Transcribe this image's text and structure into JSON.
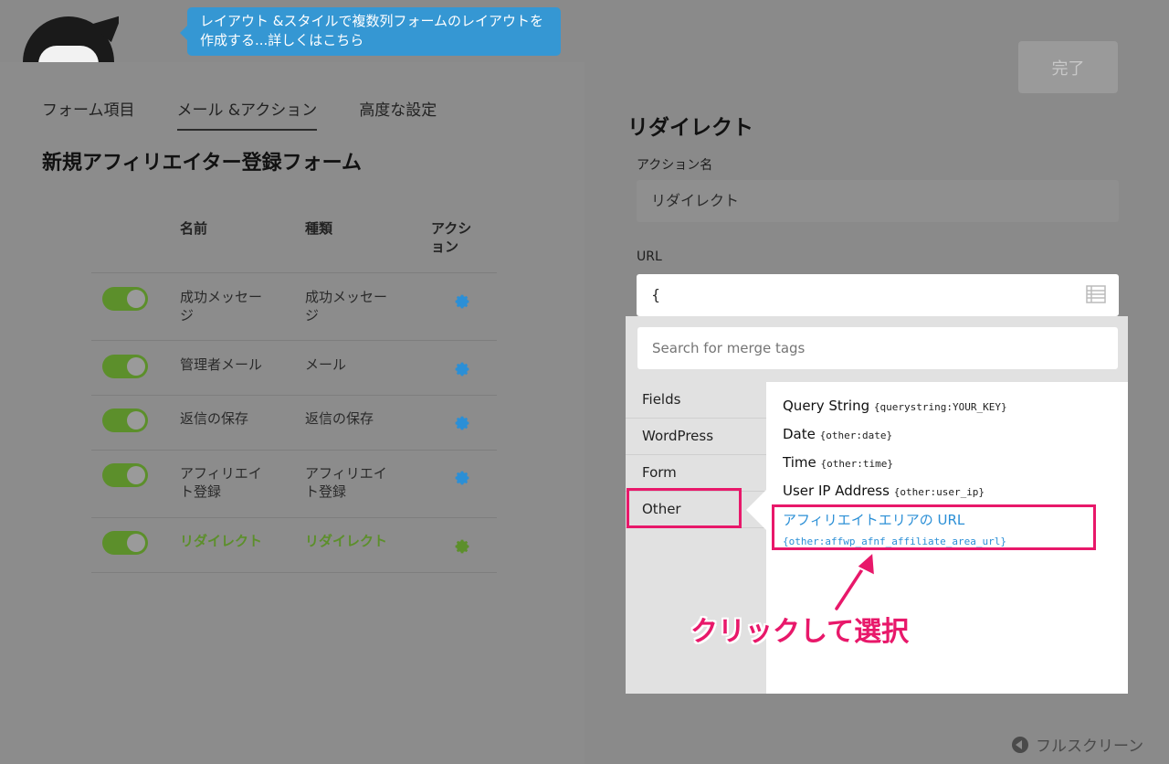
{
  "header": {
    "tooltip": "レイアウト &スタイルで複数列フォームのレイアウトを作成する...詳しくはこちら",
    "done_label": "完了"
  },
  "tabs": [
    {
      "label": "フォーム項目"
    },
    {
      "label": "メール &アクション",
      "active": true
    },
    {
      "label": "高度な設定"
    }
  ],
  "form_title": "新規アフィリエイター登録フォーム",
  "table": {
    "headers": {
      "name": "名前",
      "type": "種類",
      "actions": "アクション"
    },
    "rows": [
      {
        "name": "成功メッセージ",
        "type": "成功メッセージ",
        "enabled": true
      },
      {
        "name": "管理者メール",
        "type": "メール",
        "enabled": true
      },
      {
        "name": "返信の保存",
        "type": "返信の保存",
        "enabled": true
      },
      {
        "name": "アフィリエイト登録",
        "type": "アフィリエイト登録",
        "enabled": true
      },
      {
        "name": "リダイレクト",
        "type": "リダイレクト",
        "enabled": true,
        "highlighted": true
      }
    ]
  },
  "action_panel": {
    "title": "リダイレクト",
    "action_name_label": "アクション名",
    "action_name_value": "リダイレクト",
    "url_label": "URL",
    "url_value": "{"
  },
  "merge_tags": {
    "search_placeholder": "Search for merge tags",
    "categories": [
      {
        "label": "Fields"
      },
      {
        "label": "WordPress"
      },
      {
        "label": "Form"
      },
      {
        "label": "Other",
        "active": true
      }
    ],
    "tags": [
      {
        "label": "Query String",
        "code": "{querystring:YOUR_KEY}"
      },
      {
        "label": "Date",
        "code": "{other:date}"
      },
      {
        "label": "Time",
        "code": "{other:time}"
      },
      {
        "label": "User IP Address",
        "code": "{other:user_ip}"
      },
      {
        "label": "アフィリエイトエリアの URL",
        "code": "{other:affwp_afnf_affiliate_area_url}",
        "highlighted": true
      }
    ]
  },
  "annotation": {
    "callout": "クリックして選択"
  },
  "footer": {
    "fullscreen_label": "フルスクリーン"
  },
  "colors": {
    "accent_green": "#5c8f2b",
    "link_blue": "#2b8fd6",
    "annotation_pink": "#e8186a",
    "tooltip_blue": "#3597d3"
  }
}
